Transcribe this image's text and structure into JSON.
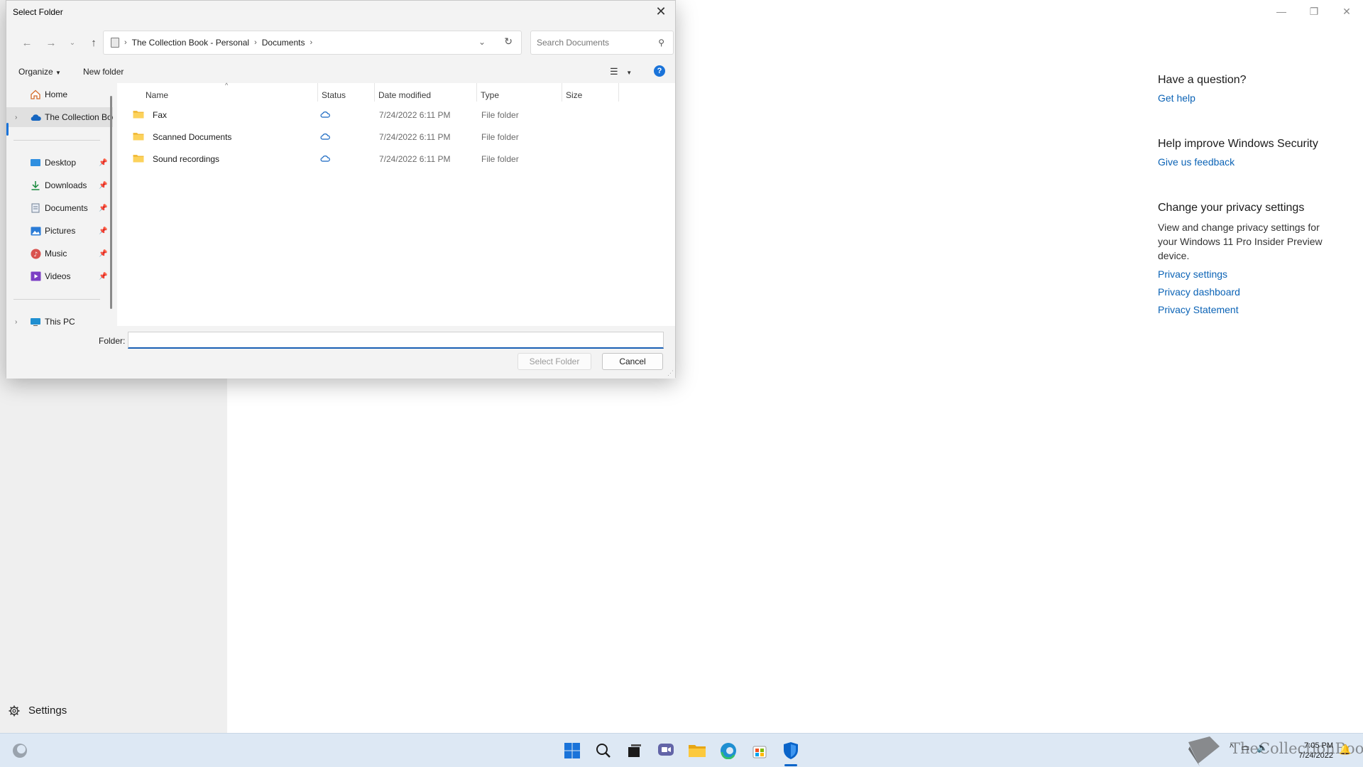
{
  "background": {
    "settings_label": "Settings",
    "right_panel": {
      "sections": [
        {
          "heading": "Have a question?",
          "links": [
            "Get help"
          ]
        },
        {
          "heading": "Help improve Windows Security",
          "links": [
            "Give us feedback"
          ]
        },
        {
          "heading": "Change your privacy settings",
          "text": "View and change privacy settings for your Windows 11 Pro Insider Preview device.",
          "links": [
            "Privacy settings",
            "Privacy dashboard",
            "Privacy Statement"
          ]
        }
      ]
    }
  },
  "dialog": {
    "title": "Select Folder",
    "breadcrumb": [
      "The Collection Book - Personal",
      "Documents"
    ],
    "search_placeholder": "Search Documents",
    "toolbar": {
      "organize": "Organize",
      "new_folder": "New folder"
    },
    "nav_pane": {
      "home": "Home",
      "onedrive": "The Collection Book - Personal",
      "quick_access": [
        "Desktop",
        "Downloads",
        "Documents",
        "Pictures",
        "Music",
        "Videos"
      ],
      "this_pc": "This PC"
    },
    "columns": {
      "name": "Name",
      "status": "Status",
      "date": "Date modified",
      "type": "Type",
      "size": "Size"
    },
    "files": [
      {
        "name": "Fax",
        "date": "7/24/2022 6:11 PM",
        "type": "File folder"
      },
      {
        "name": "Scanned Documents",
        "date": "7/24/2022 6:11 PM",
        "type": "File folder"
      },
      {
        "name": "Sound recordings",
        "date": "7/24/2022 6:11 PM",
        "type": "File folder"
      }
    ],
    "folder_label": "Folder:",
    "folder_value": "",
    "select_button": "Select Folder",
    "cancel_button": "Cancel"
  },
  "taskbar": {
    "time": "7:05 PM",
    "date": "7/24/2022",
    "watermark": "TheCollectionBook"
  },
  "colors": {
    "accent": "#1a73d9",
    "link": "#0b63b6",
    "folder": "#f2bc3c",
    "taskbar": "#dde8f4"
  }
}
